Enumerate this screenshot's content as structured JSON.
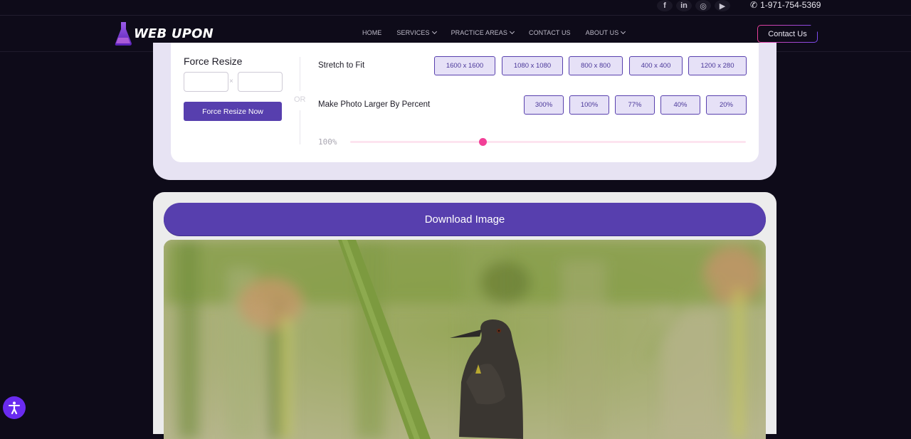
{
  "topbar": {
    "social": [
      {
        "name": "facebook-icon",
        "glyph": "f"
      },
      {
        "name": "linkedin-icon",
        "glyph": "in"
      },
      {
        "name": "instagram-icon",
        "glyph": "◎"
      },
      {
        "name": "youtube-icon",
        "glyph": "▶"
      }
    ],
    "phone_icon": "✆",
    "phone": "1-971-754-5369"
  },
  "header": {
    "logo_text": "WEB UPON",
    "nav": [
      {
        "label": "HOME",
        "dropdown": false
      },
      {
        "label": "SERVICES",
        "dropdown": true
      },
      {
        "label": "PRACTICE AREAS",
        "dropdown": true
      },
      {
        "label": "CONTACT US",
        "dropdown": false
      },
      {
        "label": "ABOUT US",
        "dropdown": true
      }
    ],
    "contact_button": "Contact Us"
  },
  "resize": {
    "force_title": "Force Resize",
    "width_value": "",
    "height_value": "",
    "times_symbol": "×",
    "force_button": "Force Resize Now",
    "or_label": "OR",
    "stretch_label": "Stretch to Fit",
    "stretch_options": [
      "1600 x 1600",
      "1080 x 1080",
      "800 x 800",
      "400 x 400",
      "1200 x 280"
    ],
    "percent_label": "Make Photo Larger By Percent",
    "percent_options": [
      "300%",
      "100%",
      "77%",
      "40%",
      "20%"
    ],
    "slider_value_text": "100%",
    "slider_fraction": 0.335
  },
  "result": {
    "download_button": "Download Image",
    "image_alt": "Dark bird perched among green reeds"
  },
  "colors": {
    "accent_purple": "#573fae",
    "slider_pink": "#f23f97",
    "page_bg": "#0e0b19"
  }
}
